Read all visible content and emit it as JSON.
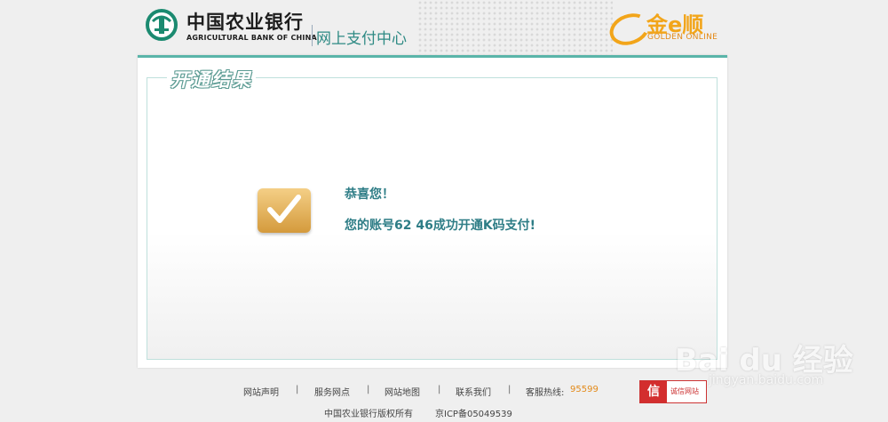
{
  "header": {
    "bank_name_cn": "中国农业银行",
    "bank_name_en": "AGRICULTURAL BANK OF CHINA",
    "section_title": "网上支付中心",
    "partner_logo_cn": "金e顺",
    "partner_logo_en": "GOLDEN ONLINE",
    "bank_logo_icon": "abc-coin-icon",
    "partner_logo_icon": "golden-online-icon"
  },
  "panel": {
    "title": "开通结果",
    "status_icon": "checkmark-icon",
    "congrats": "恭喜您！",
    "result_message": "您的账号62                         46成功开通K码支付!"
  },
  "footer": {
    "links": [
      "网站声明",
      "服务网点",
      "网站地图",
      "联系我们"
    ],
    "divider": "|",
    "hotline_label": "客服热线:",
    "hotline_number": "95599",
    "copyright": "中国农业银行版权所有",
    "icp": "京ICP备05049539",
    "trust_badge_char": "信",
    "trust_badge_text": "诚信网站"
  },
  "watermark": {
    "brand": "Bai du 经验",
    "url": "jingyan.baidu.com"
  },
  "colors": {
    "accent_teal": "#5ab5a9",
    "text_teal": "#2e7d86",
    "hotline_orange": "#e38a19",
    "gold": "#f2a51a"
  }
}
